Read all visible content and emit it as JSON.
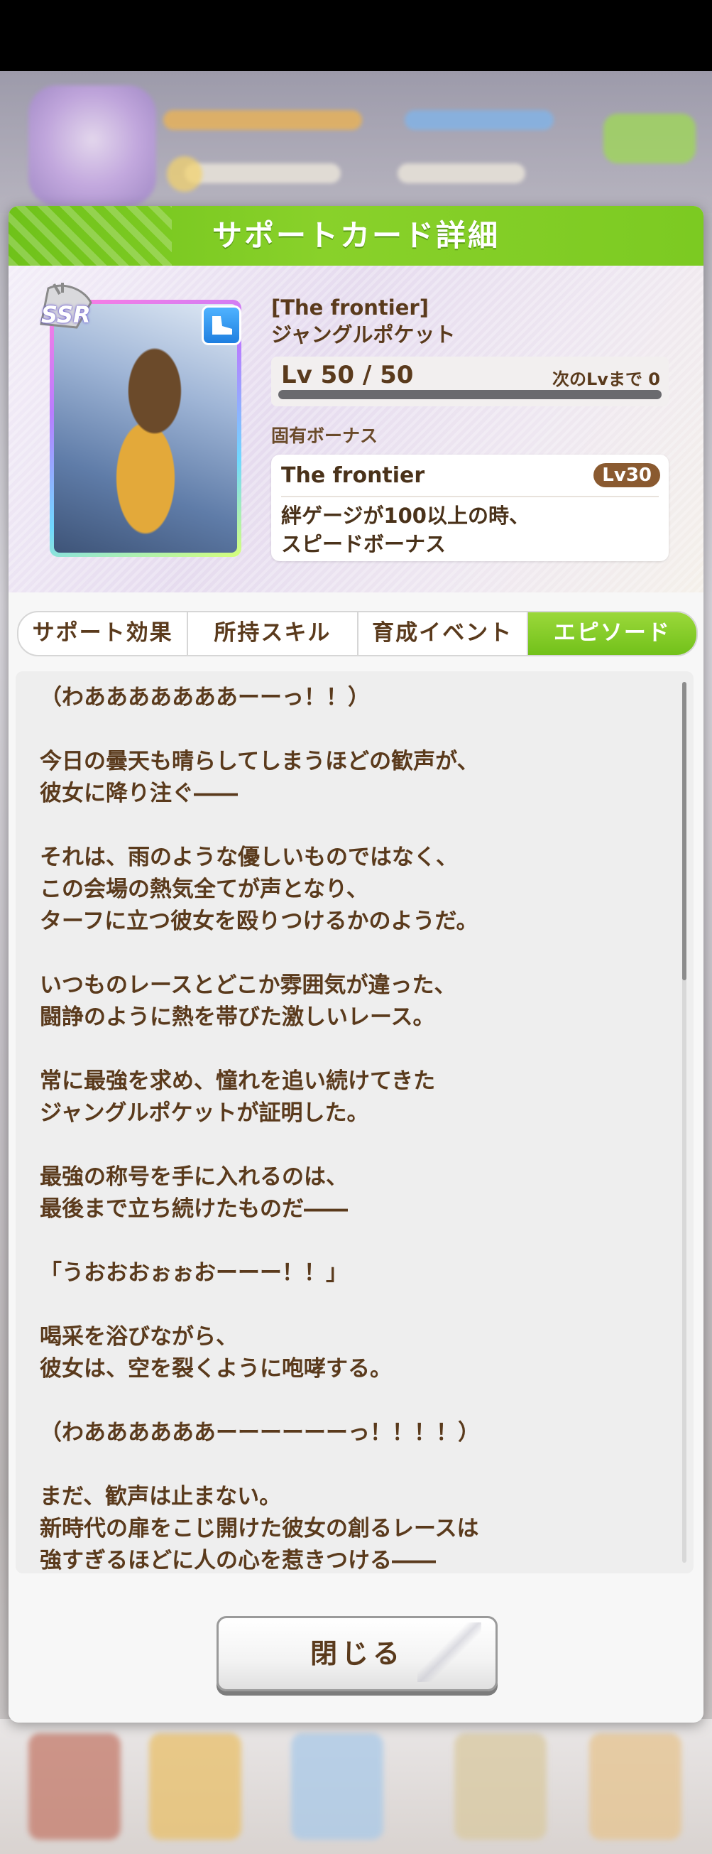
{
  "dialog": {
    "title": "サポートカード詳細",
    "close_label": "閉じる"
  },
  "card": {
    "rarity": "SSR",
    "type_icon": "speed-shoe-icon",
    "title": "[The frontier]",
    "character": "ジャングルポケット",
    "level_text": "Lv 50 / 50",
    "next_level_text": "次のLvまで 0",
    "level_progress": 1.0
  },
  "bonus": {
    "heading": "固有ボーナス",
    "name": "The frontier",
    "level": "Lv30",
    "description": "絆ゲージが100以上の時、\nスピードボーナス"
  },
  "tabs": [
    {
      "label": "サポート効果",
      "active": false
    },
    {
      "label": "所持スキル",
      "active": false
    },
    {
      "label": "育成イベント",
      "active": false
    },
    {
      "label": "エピソード",
      "active": true
    }
  ],
  "episode": {
    "text": "（わあああああああーーっ！！）\n\n今日の曇天も晴らしてしまうほどの歓声が、\n彼女に降り注ぐ――\n\nそれは、雨のような優しいものではなく、\nこの会場の熱気全てが声となり、\nターフに立つ彼女を殴りつけるかのようだ。\n\nいつものレースとどこか雰囲気が違った、\n闘諍のように熱を帯びた激しいレース。\n\n常に最強を求め、憧れを追い続けてきた\nジャングルポケットが証明した。\n\n最強の称号を手に入れるのは、\n最後まで立ち続けたものだ――\n\n「うおおおぉぉおーーー！！」\n\n喝采を浴びながら、\n彼女は、空を裂くように咆哮する。\n\n（わああああああーーーーーーっ！！！！）\n\nまだ、歓声は止まない。\n新時代の扉をこじ開けた彼女の創るレースは\n強すぎるほどに人の心を惹きつける――"
  },
  "colors": {
    "header_green": "#7cca22",
    "text_brown": "#5a3a1c",
    "tab_active": "#72c11a"
  }
}
